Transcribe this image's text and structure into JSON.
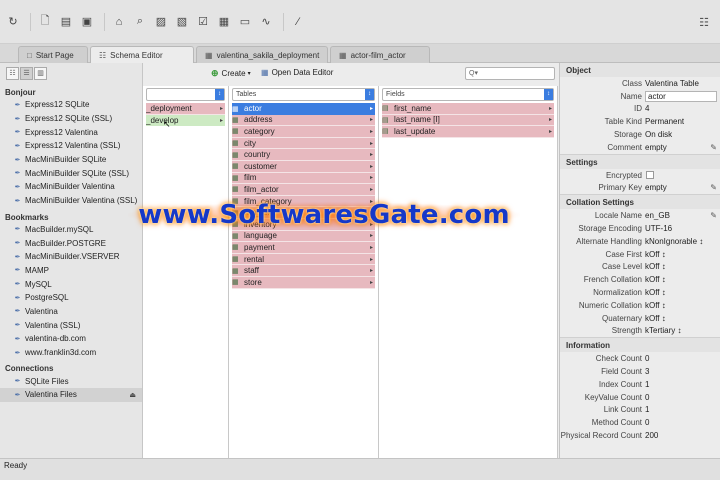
{
  "toolbar": {
    "icons": [
      "refresh-icon",
      "new-file-icon",
      "open-folder-icon",
      "save-icon",
      "home-icon",
      "search-db-icon",
      "sql-icon",
      "export-icon",
      "form-icon",
      "chart-icon",
      "monitor-icon",
      "wave-icon",
      "brush-icon",
      "help-icon"
    ]
  },
  "tabs": [
    {
      "label": "Start Page"
    },
    {
      "label": "Schema Editor"
    },
    {
      "label": "valentina_sakila_deployment"
    },
    {
      "label": "actor-film_actor"
    }
  ],
  "sidebar": {
    "sections": [
      {
        "title": "Bonjour",
        "items": [
          "Express12 SQLite",
          "Express12 SQLite (SSL)",
          "Express12 Valentina",
          "Express12 Valentina (SSL)",
          "MacMiniBuilder SQLite",
          "MacMiniBuilder SQLite (SSL)",
          "MacMiniBuilder Valentina",
          "MacMiniBuilder Valentina (SSL)"
        ]
      },
      {
        "title": "Bookmarks",
        "items": [
          "MacBuilder.mySQL",
          "MacBuilder.POSTGRE",
          "MacMiniBuilder.VSERVER",
          "MAMP",
          "MySQL",
          "PostgreSQL",
          "Valentina",
          "Valentina (SSL)",
          "valentina-db.com",
          "www.franklin3d.com"
        ]
      },
      {
        "title": "Connections",
        "items": [
          "SQLite Files",
          "Valentina Files"
        ]
      }
    ]
  },
  "schema_editor": {
    "create_label": "Create",
    "open_data_editor_label": "Open Data Editor",
    "search_placeholder": "Q▾",
    "databases": [
      "_deployment",
      "_develop"
    ],
    "tables_header": "Tables",
    "tables": [
      "actor",
      "address",
      "category",
      "city",
      "country",
      "customer",
      "film",
      "film_actor",
      "film_category",
      "film_text",
      "inventory",
      "language",
      "payment",
      "rental",
      "staff",
      "store"
    ],
    "fields_header": "Fields",
    "fields": [
      "first_name",
      "last_name [I]",
      "last_update"
    ]
  },
  "inspector": {
    "object_title": "Object",
    "object": {
      "class_label": "Class",
      "class_value": "Valentina Table",
      "name_label": "Name",
      "name_value": "actor",
      "id_label": "ID",
      "id_value": "4",
      "kind_label": "Table Kind",
      "kind_value": "Permanent",
      "storage_label": "Storage",
      "storage_value": "On disk",
      "comment_label": "Comment",
      "comment_value": "empty"
    },
    "settings_title": "Settings",
    "settings": {
      "encrypted_label": "Encrypted",
      "pk_label": "Primary Key",
      "pk_value": "empty"
    },
    "collation_title": "Collation Settings",
    "collation": [
      {
        "label": "Locale Name",
        "value": "en_GB"
      },
      {
        "label": "Storage Encoding",
        "value": "UTF-16"
      },
      {
        "label": "Alternate Handling",
        "value": "kNonIgnorable ↕"
      },
      {
        "label": "Case First",
        "value": "kOff ↕"
      },
      {
        "label": "Case Level",
        "value": "kOff ↕"
      },
      {
        "label": "French Collation",
        "value": "kOff ↕"
      },
      {
        "label": "Normalization",
        "value": "kOff ↕"
      },
      {
        "label": "Numeric Collation",
        "value": "kOff ↕"
      },
      {
        "label": "Quaternary",
        "value": "kOff ↕"
      },
      {
        "label": "Strength",
        "value": "kTertiary ↕"
      }
    ],
    "information_title": "Information",
    "information": [
      {
        "label": "Check Count",
        "value": "0"
      },
      {
        "label": "Field Count",
        "value": "3"
      },
      {
        "label": "Index Count",
        "value": "1"
      },
      {
        "label": "KeyValue Count",
        "value": "0"
      },
      {
        "label": "Link Count",
        "value": "1"
      },
      {
        "label": "Method Count",
        "value": "0"
      },
      {
        "label": "Physical Record Count",
        "value": "200"
      }
    ]
  },
  "status": {
    "text": "Ready"
  },
  "watermark": {
    "text": "www.SoftwaresGate.com"
  }
}
